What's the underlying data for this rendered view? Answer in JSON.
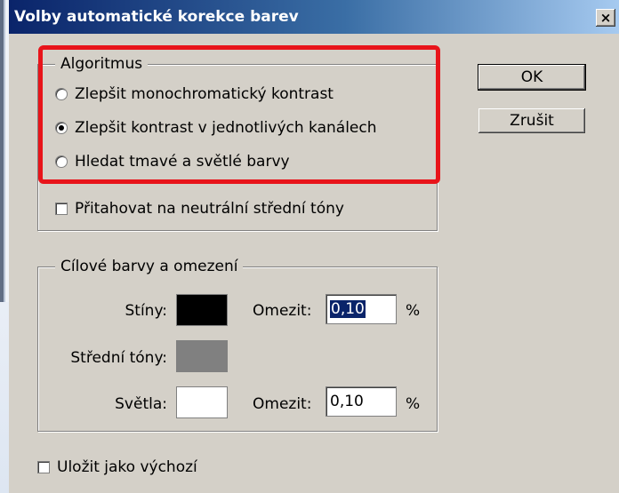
{
  "window": {
    "title": "Volby automatické korekce barev",
    "close_symbol": "×"
  },
  "algorithm_group": {
    "legend": "Algoritmus",
    "options": [
      {
        "label": "Zlepšit monochromatický kontrast",
        "selected": false
      },
      {
        "label": "Zlepšit kontrast v jednotlivých kanálech",
        "selected": true
      },
      {
        "label": "Hledat tmavé a světlé barvy",
        "selected": false
      }
    ],
    "snap_neutral_label": "Přitahovat na neutrální střední tóny",
    "snap_neutral_checked": false
  },
  "buttons": {
    "ok": "OK",
    "cancel": "Zrušit"
  },
  "target_group": {
    "legend": "Cílové barvy a omezení",
    "shadows": {
      "label": "Stíny:",
      "color": "#000000",
      "clip_label": "Omezit:",
      "clip_value": "0,10",
      "unit": "%"
    },
    "midtones": {
      "label": "Střední tóny:",
      "color": "#808080"
    },
    "highlights": {
      "label": "Světla:",
      "color": "#ffffff",
      "clip_label": "Omezit:",
      "clip_value": "0,10",
      "unit": "%"
    }
  },
  "save_default": {
    "label": "Uložit jako výchozí",
    "checked": false
  },
  "colors": {
    "annotation_highlight": "#e8141a",
    "titlebar_start": "#0a246a"
  }
}
